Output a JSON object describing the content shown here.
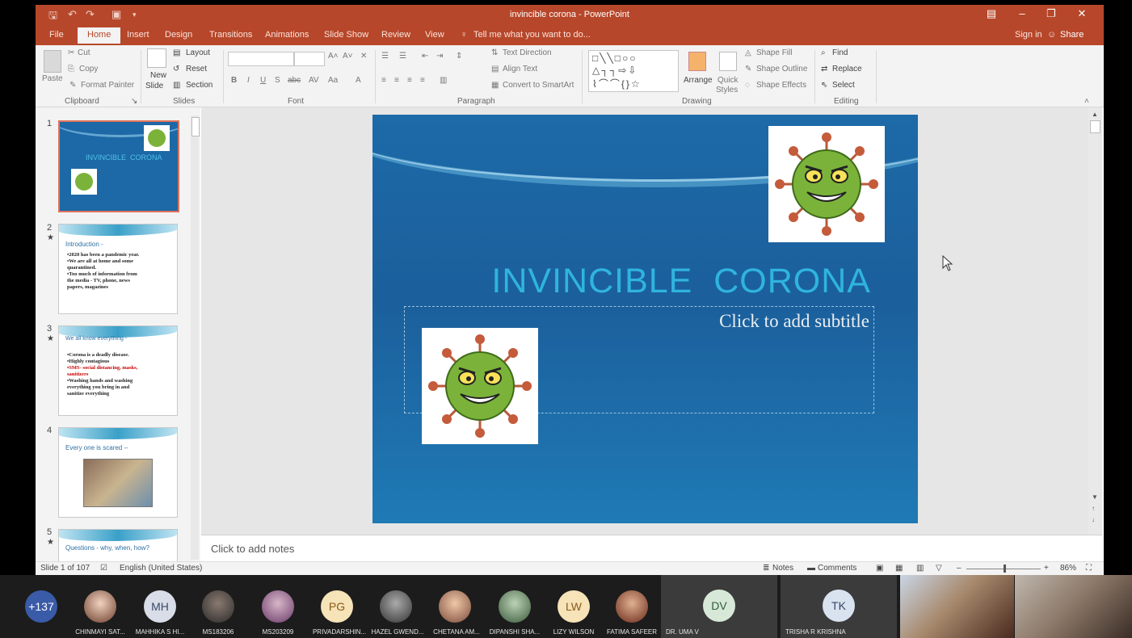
{
  "window": {
    "title": "invincible corona - PowerPoint",
    "sign_in": "Sign in",
    "share": "Share"
  },
  "tabs": [
    "File",
    "Home",
    "Insert",
    "Design",
    "Transitions",
    "Animations",
    "Slide Show",
    "Review",
    "View"
  ],
  "tell_me": "Tell me what you want to do...",
  "ribbon": {
    "clipboard": {
      "group": "Clipboard",
      "paste": "Paste",
      "cut": "Cut",
      "copy": "Copy",
      "format_painter": "Format Painter"
    },
    "slides": {
      "group": "Slides",
      "new_slide": "New",
      "new_slide2": "Slide",
      "layout": "Layout",
      "reset": "Reset",
      "section": "Section"
    },
    "font": {
      "group": "Font",
      "clear": "A"
    },
    "paragraph": {
      "group": "Paragraph",
      "text_direction": "Text Direction",
      "align_text": "Align Text",
      "convert": "Convert to SmartArt"
    },
    "drawing": {
      "group": "Drawing",
      "arrange": "Arrange",
      "quick_styles": "Quick",
      "quick_styles2": "Styles",
      "shape_fill": "Shape Fill",
      "shape_outline": "Shape Outline",
      "shape_effects": "Shape Effects"
    },
    "editing": {
      "group": "Editing",
      "find": "Find",
      "replace": "Replace",
      "select": "Select"
    }
  },
  "thumbnails": [
    {
      "num": "1",
      "title": "INVINCIBLE  CORONA",
      "lines": []
    },
    {
      "num": "2",
      "title": "Introduction -",
      "lines": [
        "•2020 has been a pandemic year.",
        "•We are all at home and some",
        "  quarantined.",
        "•Too much of information from",
        "  the media - TV, phone, news",
        "  papers, magazines"
      ]
    },
    {
      "num": "3",
      "title": "We all know everything -",
      "lines": [
        "•Corona is a deadly disease.",
        "•Highly contagious",
        "•SMS- social distancing, masks,",
        "  sanitizers",
        "•Washing hands and washing",
        "  everything you bring in and",
        "  sanitize everything"
      ]
    },
    {
      "num": "4",
      "title": "Every one is scared --",
      "lines": []
    },
    {
      "num": "5",
      "title": "Questions - why, when, how?",
      "lines": []
    }
  ],
  "slide": {
    "title": "INVINCIBLE  CORONA",
    "subtitle_placeholder": "Click to add subtitle"
  },
  "notes_placeholder": "Click to add notes",
  "status": {
    "slide_of": "Slide 1 of 107",
    "language": "English (United States)",
    "notes": "Notes",
    "comments": "Comments",
    "zoom": "86%"
  },
  "participants": {
    "more": "+137",
    "people": [
      {
        "name": "CHINMAYI SAT...",
        "initials": ""
      },
      {
        "name": "MAHHIKA S HI...",
        "initials": "MH"
      },
      {
        "name": "MS183206",
        "initials": ""
      },
      {
        "name": "MS203209",
        "initials": ""
      },
      {
        "name": "PRIVADARSHIN...",
        "initials": "PG"
      },
      {
        "name": "HAZEL GWEND...",
        "initials": ""
      },
      {
        "name": "CHETANA AM...",
        "initials": ""
      },
      {
        "name": "DIPANSHI SHA...",
        "initials": ""
      },
      {
        "name": "LIZY WILSON",
        "initials": "LW"
      },
      {
        "name": "FATIMA SAFEER",
        "initials": ""
      }
    ],
    "cards": [
      {
        "name": "DR. UMA V",
        "initials": "DV"
      },
      {
        "name": "TRISHA R KRISHNA",
        "initials": "TK"
      }
    ]
  },
  "colors": {
    "accent": "#b7472a",
    "slide_title": "#2fb4df",
    "selected_thumb": "#e0735a"
  }
}
